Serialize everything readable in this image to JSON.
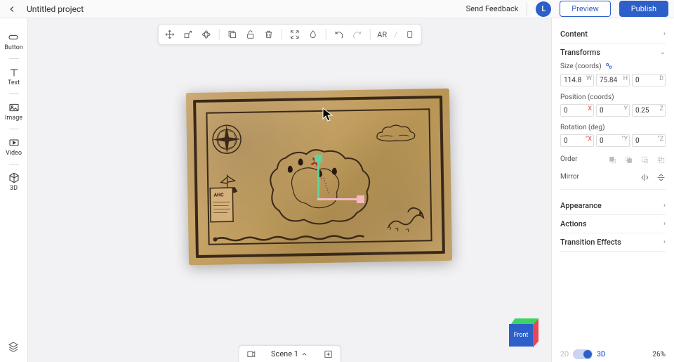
{
  "header": {
    "title": "Untitled project",
    "feedback": "Send Feedback",
    "avatar_letter": "L",
    "preview": "Preview",
    "publish": "Publish"
  },
  "tools": {
    "button": "Button",
    "text": "Text",
    "image": "Image",
    "video": "Video",
    "threeD": "3D"
  },
  "toolbar": {
    "ar": "AR"
  },
  "scene": {
    "label": "Scene 1"
  },
  "cube": {
    "face": "Front"
  },
  "panel": {
    "content": "Content",
    "transforms": "Transforms",
    "size_label": "Size (coords)",
    "position_label": "Position (coords)",
    "rotation_label": "Rotation (deg)",
    "order_label": "Order",
    "mirror_label": "Mirror",
    "appearance": "Appearance",
    "actions": "Actions",
    "transition": "Transition Effects",
    "size": {
      "w": "114.8",
      "h": "75.84",
      "d": "0"
    },
    "position": {
      "x": "0",
      "y": "0",
      "z": "0.25"
    },
    "rotation": {
      "x": "0",
      "y": "0",
      "z": "0"
    }
  },
  "bottom": {
    "label_2d": "2D",
    "label_3d": "3D",
    "zoom": "26%"
  }
}
